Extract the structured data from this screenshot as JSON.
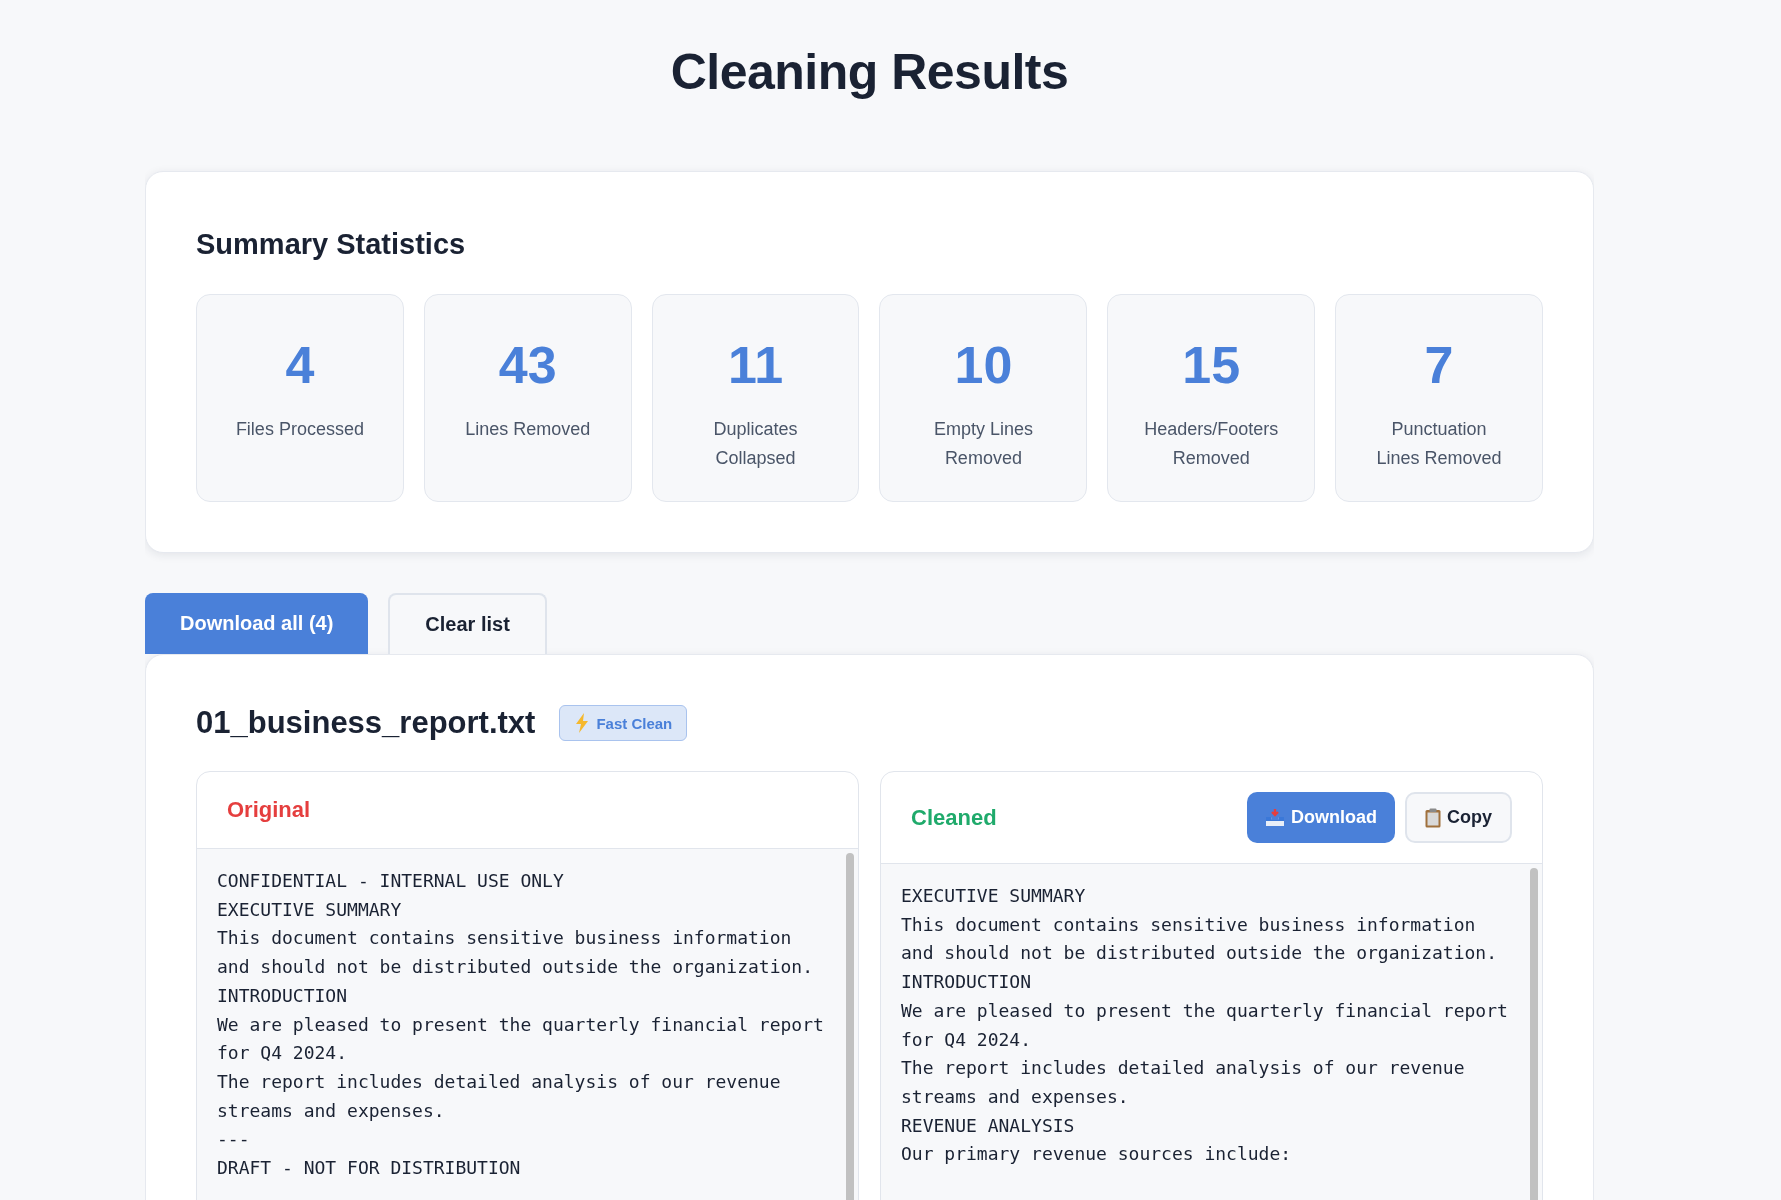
{
  "page": {
    "title": "Cleaning Results"
  },
  "summary": {
    "title": "Summary Statistics",
    "stats": [
      {
        "value": "4",
        "label": "Files Processed"
      },
      {
        "value": "43",
        "label": "Lines Removed"
      },
      {
        "value": "11",
        "label": "Duplicates Collapsed"
      },
      {
        "value": "10",
        "label": "Empty Lines Removed"
      },
      {
        "value": "15",
        "label": "Headers/Footers Removed"
      },
      {
        "value": "7",
        "label": "Punctuation Lines Removed"
      }
    ]
  },
  "actions": [
    {
      "label": "Download all (4)",
      "kind": "primary"
    },
    {
      "label": "Clear list",
      "kind": "secondary"
    }
  ],
  "file": {
    "name": "01_business_report.txt",
    "badge": "Fast Clean",
    "panels": [
      {
        "title": "Original",
        "kind": "original",
        "lines": [
          "CONFIDENTIAL - INTERNAL USE ONLY",
          "EXECUTIVE SUMMARY",
          "This document contains sensitive business information",
          "and should not be distributed outside the organization.",
          "INTRODUCTION",
          "We are pleased to present the quarterly financial report",
          "for Q4 2024.",
          "The report includes detailed analysis of our revenue",
          "streams and expenses.",
          "---",
          "DRAFT - NOT FOR DISTRIBUTION"
        ]
      },
      {
        "title": "Cleaned",
        "kind": "cleaned",
        "buttons": [
          {
            "label": "Download",
            "kind": "primary"
          },
          {
            "label": "Copy",
            "kind": "secondary"
          }
        ],
        "lines": [
          "EXECUTIVE SUMMARY",
          "This document contains sensitive business information",
          "and should not be distributed outside the organization.",
          "INTRODUCTION",
          "We are pleased to present the quarterly financial report",
          "for Q4 2024.",
          "The report includes detailed analysis of our revenue",
          "streams and expenses.",
          "REVENUE ANALYSIS",
          "Our primary revenue sources include:"
        ]
      }
    ]
  }
}
